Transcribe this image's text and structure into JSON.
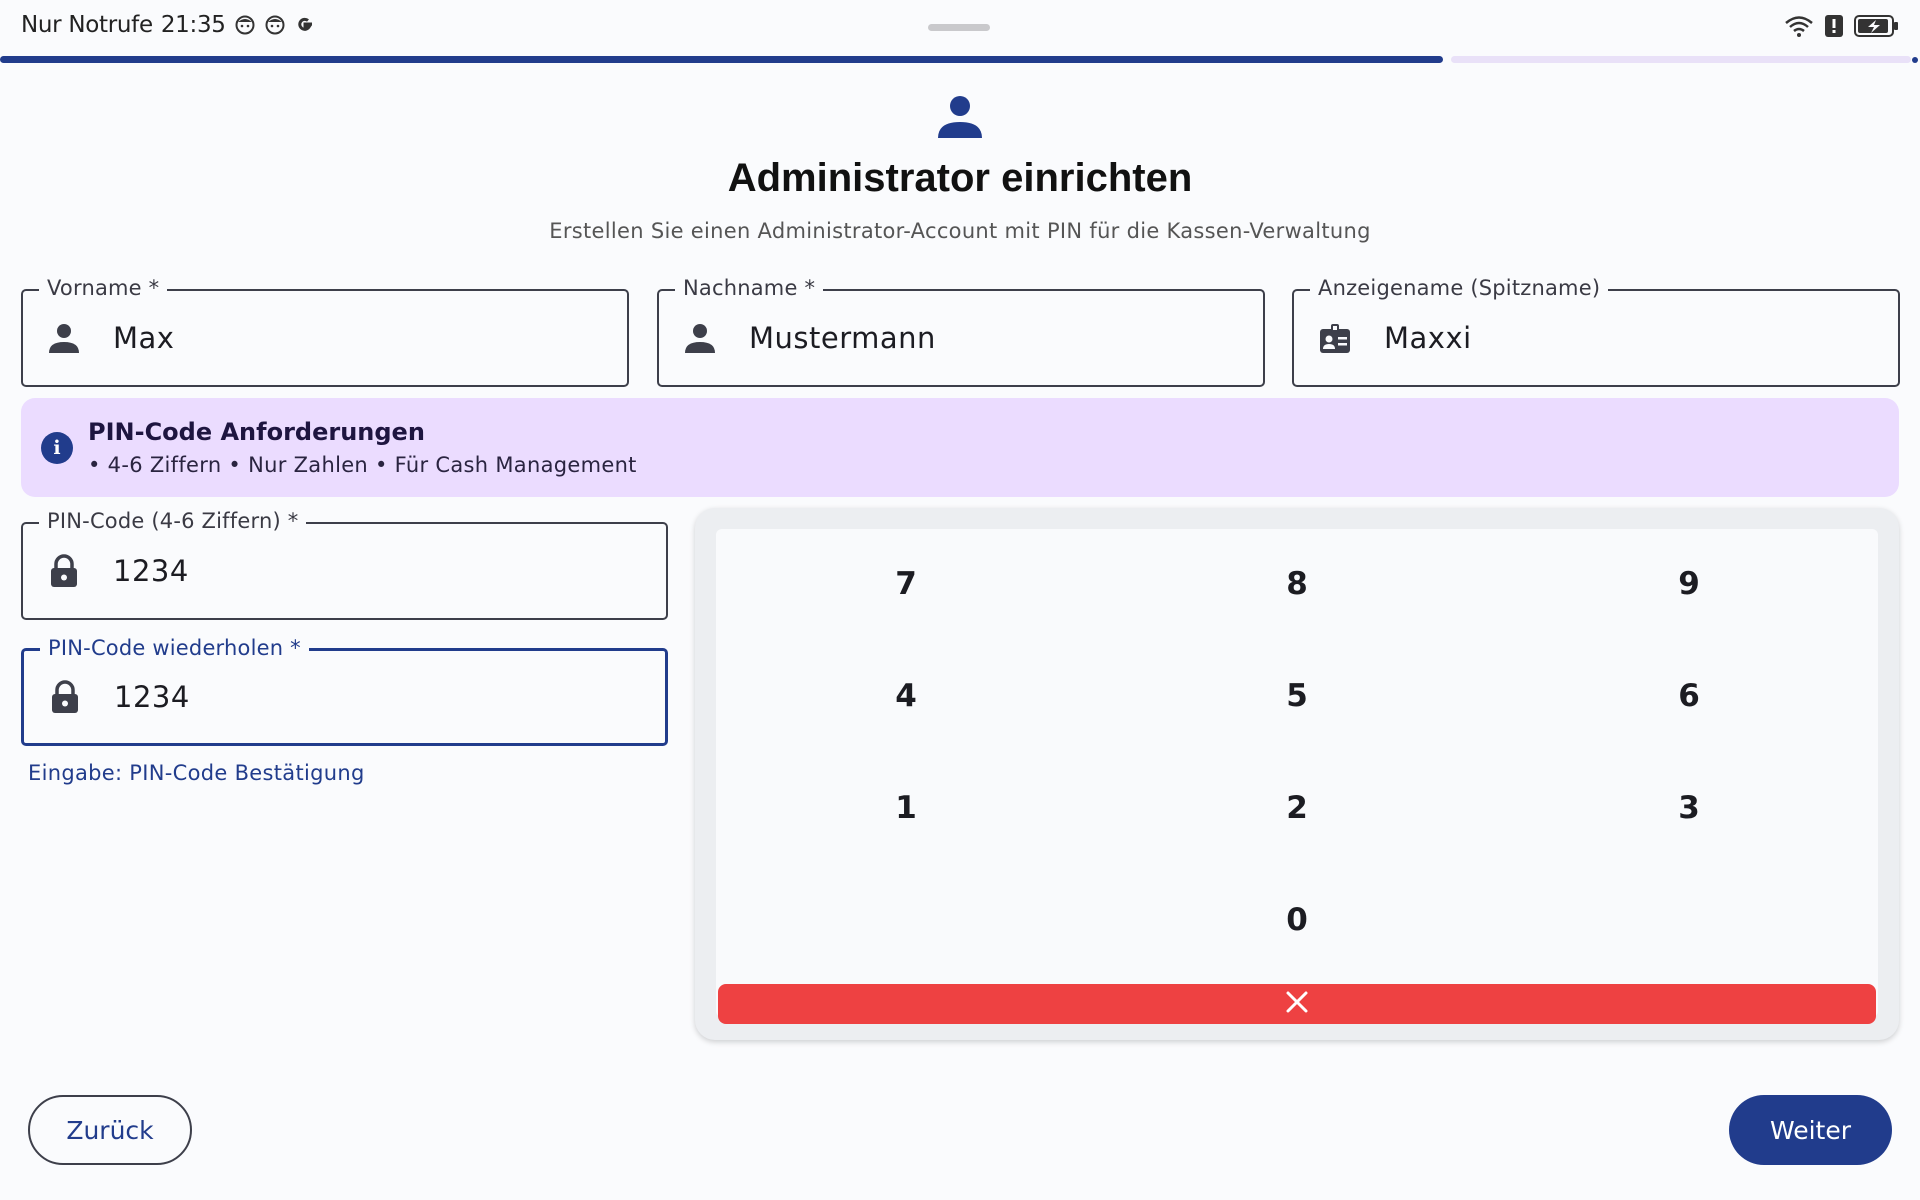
{
  "status_bar": {
    "carrier_text": "Nur Notrufe",
    "time": "21:35",
    "left_icons": [
      "face-icon",
      "face-icon",
      "google-icon"
    ],
    "right_icons": [
      "wifi-icon",
      "alert-icon",
      "battery-charging-icon"
    ]
  },
  "progress": {
    "fraction": 0.75
  },
  "header": {
    "icon": "person-icon",
    "title": "Administrator einrichten",
    "subtitle": "Erstellen Sie einen Administrator-Account mit PIN für die Kassen-Verwaltung"
  },
  "fields": {
    "first_name": {
      "label": "Vorname *",
      "value": "Max",
      "icon": "person-icon"
    },
    "last_name": {
      "label": "Nachname *",
      "value": "Mustermann",
      "icon": "person-icon"
    },
    "display_name": {
      "label": "Anzeigename (Spitzname)",
      "value": "Maxxi",
      "icon": "badge-icon"
    },
    "pin": {
      "label": "PIN-Code (4-6 Ziffern) *",
      "value": "1234",
      "icon": "lock-icon"
    },
    "pin_repeat": {
      "label": "PIN-Code wiederholen *",
      "value": "1234",
      "icon": "lock-icon"
    }
  },
  "info": {
    "icon": "info-icon",
    "title": "PIN-Code Anforderungen",
    "text": "• 4-6 Ziffern • Nur Zahlen • Für Cash Management"
  },
  "helper_text": "Eingabe: PIN-Code Bestätigung",
  "keypad": {
    "rows": [
      [
        "7",
        "8",
        "9"
      ],
      [
        "4",
        "5",
        "6"
      ],
      [
        "1",
        "2",
        "3"
      ],
      [
        "",
        "0",
        ""
      ]
    ],
    "clear_icon": "close-icon",
    "clear_color": "#ee4142"
  },
  "buttons": {
    "back": "Zurück",
    "next": "Weiter"
  },
  "colors": {
    "primary": "#213c8c",
    "info_bg": "#ebdcff",
    "danger": "#ee4142"
  }
}
